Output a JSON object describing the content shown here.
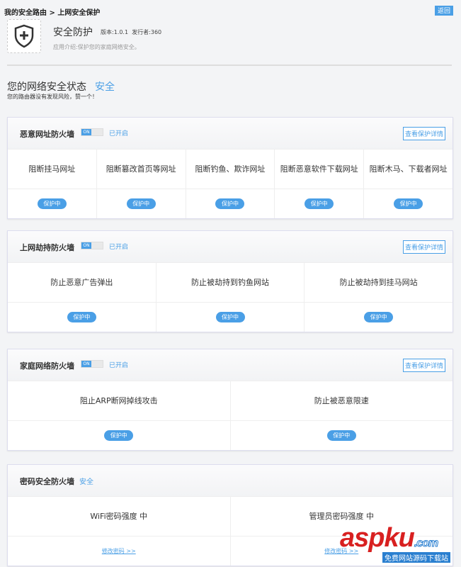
{
  "breadcrumb": "我的安全路由 > 上网安全保护",
  "back_label": "返回",
  "app": {
    "title": "安全防护",
    "version": "版本:1.0.1",
    "publisher": "发行者:360",
    "desc": "应用介绍:保护您的家庭网络安全。"
  },
  "status": {
    "label": "您的网络安全状态",
    "value": "安全",
    "sub": "您的路由器没有发现风险，赞一个！"
  },
  "cards": [
    {
      "title": "恶意网址防火墙",
      "toggle": "ON",
      "state": "已开启",
      "details": "查看保护详情",
      "items": [
        "阻断挂马网址",
        "阻断篡改首页等网址",
        "阻断钓鱼、欺诈网址",
        "阻断恶意软件下载网址",
        "阻断木马、下载者网址"
      ],
      "badge": "保护中"
    },
    {
      "title": "上网劫持防火墙",
      "toggle": "ON",
      "state": "已开启",
      "details": "查看保护详情",
      "items": [
        "防止恶意广告弹出",
        "防止被劫持到钓鱼网站",
        "防止被劫持到挂马网站"
      ],
      "badge": "保护中"
    },
    {
      "title": "家庭网络防火墙",
      "toggle": "ON",
      "state": "已开启",
      "details": "查看保护详情",
      "items": [
        "阻止ARP断网掉线攻击",
        "防止被恶意限速"
      ],
      "badge": "保护中"
    },
    {
      "title": "密码安全防火墙",
      "state": "安全",
      "items": [
        "WiFi密码强度 中",
        "管理员密码强度 中"
      ],
      "link": "修改密码 >>"
    }
  ],
  "watermark": {
    "logo": "aspku",
    "sub": "免费网站源码下载站"
  }
}
